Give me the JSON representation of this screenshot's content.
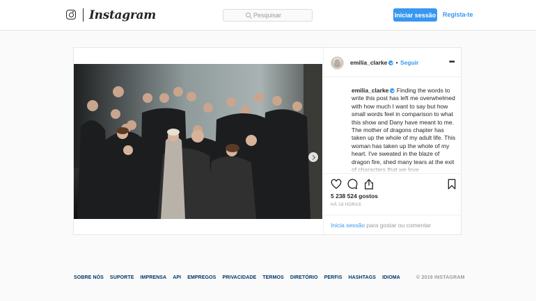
{
  "header": {
    "logo_text": "Instagram",
    "search_placeholder": "Pesquisar",
    "login_label": "Iniciar sessão",
    "register_label": "Regista-te"
  },
  "post": {
    "username": "emilia_clarke",
    "bullet": "•",
    "follow_label": "Seguir",
    "more_icon": "•••",
    "caption_user": "emilia_clarke",
    "caption_text": "Finding the words to write this post has left me overwhelmed with how much I want to say but how small words feel in comparison to what this show and Dany have meant to me.\nThe mother of dragons chapter has taken up the whole of my adult life. This woman has taken up the whole of my heart. I've sweated in the blaze of dragon fire, shed many tears at the exit of characters that we love",
    "likes": "5 238 524 gostos",
    "time": "HÁ 18 HORAS",
    "login_prompt_link": "Inicia sessão",
    "login_prompt_rest": " para gostar ou comentar",
    "carousel": {
      "count": 4,
      "active": 1
    },
    "icons": [
      "heart-icon",
      "comment-icon",
      "share-icon",
      "bookmark-icon",
      "verified-icon",
      "chevron-right-icon"
    ]
  },
  "footer": {
    "links": [
      "SOBRE NÓS",
      "SUPORTE",
      "IMPRENSA",
      "API",
      "EMPREGOS",
      "PRIVACIDADE",
      "TERMOS",
      "DIRETÓRIO",
      "PERFIS",
      "HASHTAGS",
      "IDIOMA"
    ],
    "copyright": "© 2019 INSTAGRAM"
  },
  "colors": {
    "accent": "#3897f0",
    "link_dark": "#003569",
    "muted": "#999999",
    "background": "#fafafa"
  }
}
